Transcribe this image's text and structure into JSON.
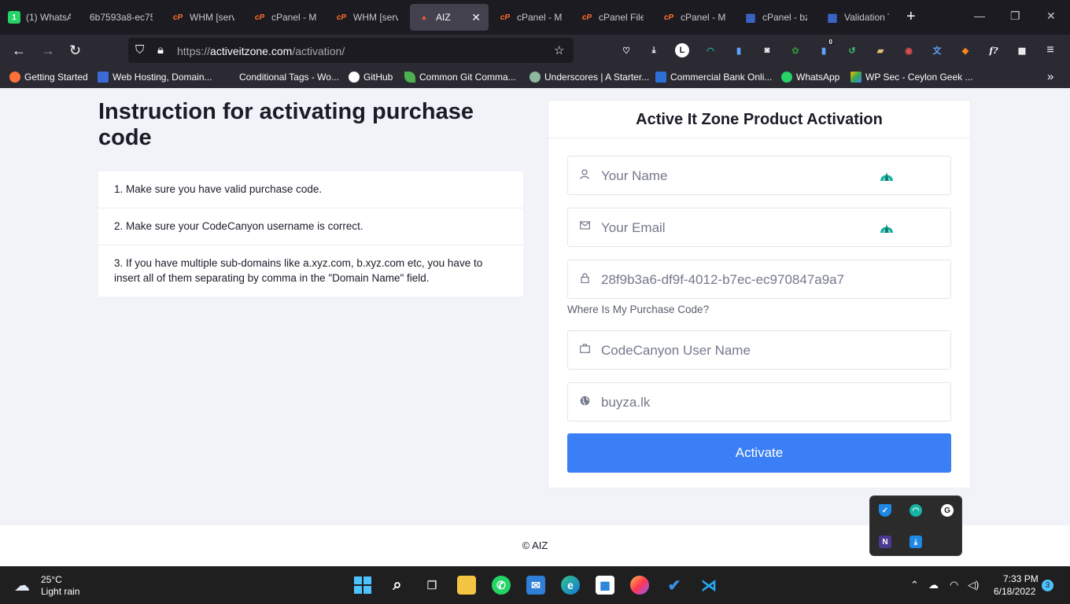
{
  "browser": {
    "tabs": [
      {
        "title": "(1) WhatsAp",
        "icon": "whatsapp-icon"
      },
      {
        "title": "6b7593a8-ec75",
        "icon": "blank-icon"
      },
      {
        "title": "WHM [serv",
        "icon": "cpanel-icon"
      },
      {
        "title": "cPanel - M",
        "icon": "cpanel-icon"
      },
      {
        "title": "WHM [serv",
        "icon": "cpanel-icon"
      },
      {
        "title": "AIZ",
        "icon": "aiz-icon",
        "active": true
      },
      {
        "title": "cPanel - M",
        "icon": "cpanel-icon"
      },
      {
        "title": "cPanel File",
        "icon": "cpanel-icon"
      },
      {
        "title": "cPanel - M",
        "icon": "cpanel-icon"
      },
      {
        "title": "cPanel - bz",
        "icon": "grid-icon"
      },
      {
        "title": "Validation T",
        "icon": "grid-icon"
      }
    ],
    "new_tab_glyph": "+",
    "close_glyph": "✕",
    "url_prefix": "https://",
    "url_domain": "activeitzone.com",
    "url_path": "/activation/",
    "extension_badge": "0",
    "bookmarks": [
      {
        "label": "Getting Started"
      },
      {
        "label": "Web Hosting, Domain..."
      },
      {
        "label": "Conditional Tags - Wo..."
      },
      {
        "label": "GitHub"
      },
      {
        "label": "Common Git Comma..."
      },
      {
        "label": "Underscores | A Starter..."
      },
      {
        "label": "Commercial Bank Onli..."
      },
      {
        "label": "WhatsApp"
      },
      {
        "label": "WP Sec - Ceylon Geek ..."
      }
    ]
  },
  "page": {
    "title": "Instruction for activating purchase code",
    "instructions": [
      "1. Make sure you have valid purchase code.",
      "2. Make sure your CodeCanyon username is correct.",
      "3. If you have multiple sub-domains like a.xyz.com, b.xyz.com etc, you have to insert all of them separating by comma in the \"Domain Name\" field."
    ],
    "form": {
      "heading": "Active It Zone Product Activation",
      "name_placeholder": "Your Name",
      "email_placeholder": "Your Email",
      "purchase_code": "28f9b3a6-df9f-4012-b7ec-ec970847a9a7",
      "purchase_hint": "Where Is My Purchase Code?",
      "username_placeholder": "CodeCanyon User Name",
      "domain_value": "buyza.lk",
      "submit_label": "Activate"
    },
    "footer": "© AIZ"
  },
  "taskbar": {
    "temperature": "25°C",
    "weather": "Light rain",
    "time": "7:33 PM",
    "date": "6/18/2022",
    "notifications": "3"
  },
  "colors": {
    "accent": "#3a7ff5",
    "tab_bar": "#1c1b22",
    "nav_bar": "#2b2a33"
  }
}
